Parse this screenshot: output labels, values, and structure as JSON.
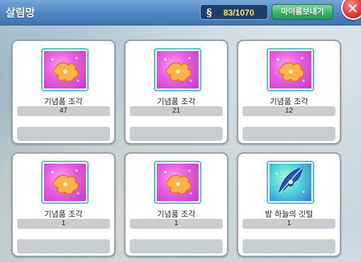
{
  "header": {
    "title": "살림망",
    "currency_icon": "hook-icon",
    "currency_text": "83/1070",
    "send_button_label": "마이룸보내기",
    "close_icon": "close-icon"
  },
  "items": [
    {
      "name": "기념품 조각",
      "count": "47",
      "icon": "paw-fragment-icon",
      "icon_bg": "#e85be0"
    },
    {
      "name": "기념품 조각",
      "count": "21",
      "icon": "paw-fragment-icon",
      "icon_bg": "#e85be0"
    },
    {
      "name": "기념품 조각",
      "count": "12",
      "icon": "paw-fragment-icon",
      "icon_bg": "#e85be0"
    },
    {
      "name": "기념품 조각",
      "count": "1",
      "icon": "paw-fragment-icon",
      "icon_bg": "#e85be0"
    },
    {
      "name": "기념품 조각",
      "count": "1",
      "icon": "paw-fragment-icon",
      "icon_bg": "#e85be0"
    },
    {
      "name": "밤 하늘의 깃털",
      "count": "1",
      "icon": "feather-icon",
      "icon_bg": "#4fd3d8"
    }
  ],
  "colors": {
    "header": "#4f86c2",
    "currency_value": "#ffe36a",
    "send_button": "#3fb36a",
    "close_button": "#e23a3a",
    "card_border": "#9aa0a6",
    "icon_frame": "#4cc4d8"
  }
}
